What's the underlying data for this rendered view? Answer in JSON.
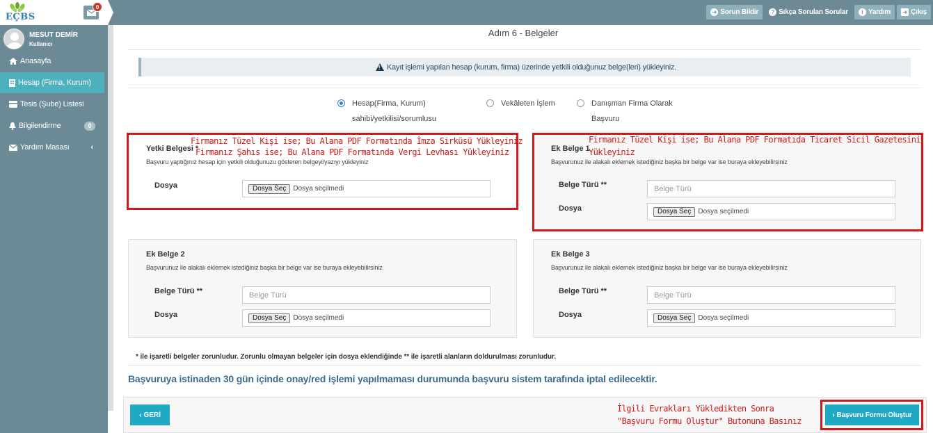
{
  "header": {
    "logo_text": "EÇBS",
    "mail_badge": "0",
    "actions": [
      {
        "label": "Sorun Bildir",
        "icon": "report-icon"
      },
      {
        "label": "Sıkça Sorulan Sorular",
        "icon": "question-icon"
      },
      {
        "label": "Yardım",
        "icon": "info-icon"
      },
      {
        "label": "Çıkış",
        "icon": "logout-icon"
      }
    ]
  },
  "user": {
    "name": "MESUT DEMİR",
    "role": "Kullanıcı"
  },
  "sidebar": {
    "items": [
      {
        "label": "Anasayfa",
        "icon": "home-icon"
      },
      {
        "label": "Hesap (Firma, Kurum)",
        "icon": "building-icon",
        "active": true
      },
      {
        "label": "Tesis (Şube) Listesi",
        "icon": "list-icon"
      },
      {
        "label": "Bilgilendirme",
        "icon": "bell-icon",
        "badge": "0"
      },
      {
        "label": "Yardım Masası",
        "icon": "envelope-icon"
      }
    ]
  },
  "main": {
    "title": "Adım 6 - Belgeler",
    "info": "Kayıt işlemi yapılan hesap (kurum, firma) üzerinde yetkili olduğunuz belge(leri) yükleyiniz.",
    "radios": [
      {
        "line1": "Hesap(Firma, Kurum)",
        "line2": "sahibi/yetkilisi/sorumlusu",
        "checked": true
      },
      {
        "line1": "Vekâleten İşlem",
        "line2": "",
        "checked": false
      },
      {
        "line1": "Danışman Firma Olarak",
        "line2": "Başvuru",
        "checked": false
      }
    ],
    "cards": {
      "yetki": {
        "title": "Yetki Belgesi *",
        "desc": "Başvuru yaptığınız hesap için yetkili olduğunuzu gösteren belgeyi/yazıyı yükleyiniz",
        "file_label": "Dosya"
      },
      "ek1": {
        "title": "Ek Belge 1",
        "desc": "Başvurunuz ile alakalı eklemek istediğiniz başka bir belge var ise buraya ekleyebilirsiniz",
        "type_label": "Belge Türü **",
        "file_label": "Dosya"
      },
      "ek2": {
        "title": "Ek Belge 2",
        "desc": "Başvurunuz ile alakalı eklemek istediğiniz başka bir belge var ise buraya ekleyebilirsiniz",
        "type_label": "Belge Türü **",
        "file_label": "Dosya"
      },
      "ek3": {
        "title": "Ek Belge 3",
        "desc": "Başvurunuz ile alakalı eklemek istediğiniz başka bir belge var ise buraya ekleyebilirsiniz",
        "type_label": "Belge Türü **",
        "file_label": "Dosya"
      }
    },
    "type_placeholder": "Belge Türü",
    "file_button": "Dosya Seç",
    "file_status": "Dosya seçilmedi",
    "note": "* ile işaretli belgeler zorunludur. Zorunlu olmayan belgeler için dosya eklendiğinde ** ile işaretli alanların doldurulması zorunludur.",
    "warning": "Başvuruya istinaden 30 gün içinde onay/red işlemi yapılmaması durumunda başvuru sistem tarafında iptal edilecektir."
  },
  "annotations": {
    "left_line1": "Firmanız Tüzel Kişi ise; Bu Alana PDF Formatında İmza Sirküsü Yükleyiniz",
    "left_line2": "Firmanız  Şahıs ise; Bu Alana PDF Formatında Vergi Levhası Yükleyiniz",
    "right_line1": "Firmanız Tüzel Kişi ise; Bu Alana PDF Formatıda Ticaret Sicil Gazetesini",
    "right_line2": "Yükleyiniz",
    "footer_line1": "İlgili Evrakları Yükledikten Sonra",
    "footer_line2": "\"Başvuru Formu Oluştur\" Butonuna Basınız"
  },
  "footer": {
    "back_label": "GERİ",
    "submit_label": "Başvuru Formu Oluştur"
  },
  "colors": {
    "sidebar": "#6b8a95",
    "accent": "#1fa9c3",
    "annotation_red": "#d01a1a"
  }
}
